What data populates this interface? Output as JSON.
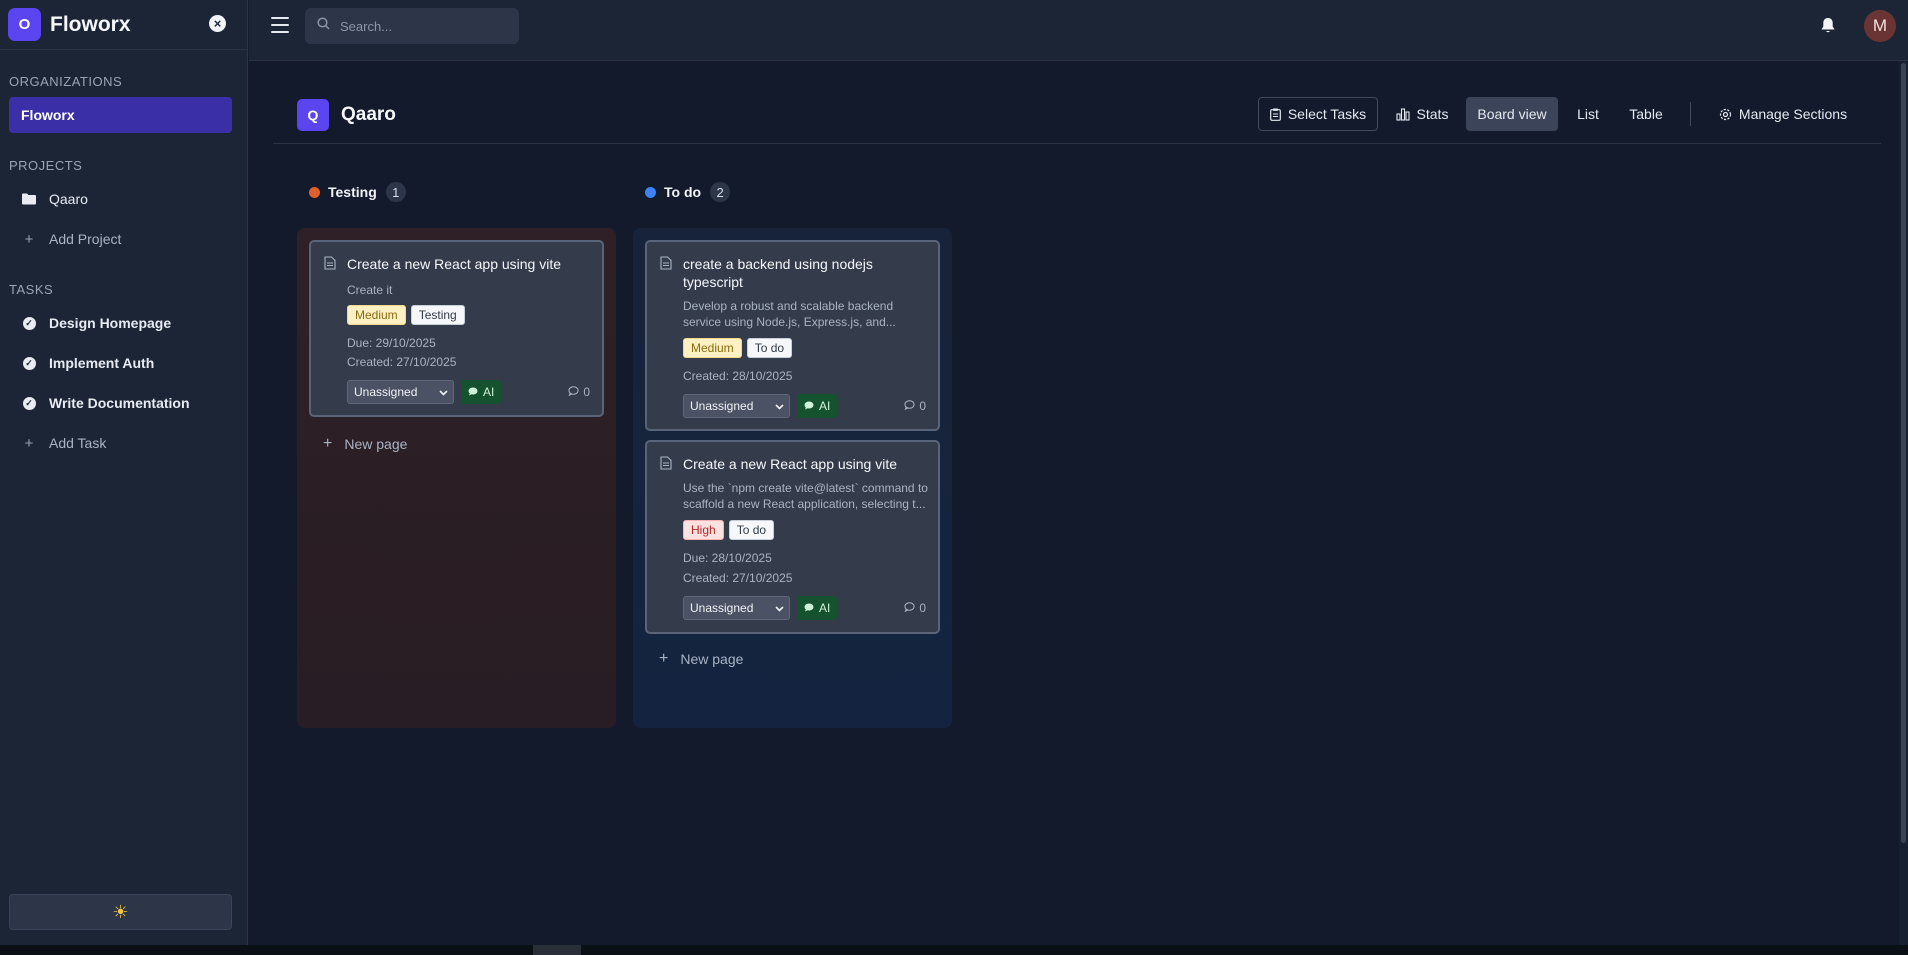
{
  "brand": {
    "logo_letter": "O",
    "name": "Floworx"
  },
  "sidebar": {
    "organizations_heading": "ORGANIZATIONS",
    "organizations": [
      {
        "label": "Floworx"
      }
    ],
    "projects_heading": "PROJECTS",
    "projects": [
      {
        "label": "Qaaro"
      }
    ],
    "add_project_label": "Add Project",
    "tasks_heading": "TASKS",
    "tasks": [
      {
        "label": "Design Homepage"
      },
      {
        "label": "Implement Auth"
      },
      {
        "label": "Write Documentation"
      }
    ],
    "add_task_label": "Add Task"
  },
  "search": {
    "placeholder": "Search..."
  },
  "user": {
    "avatar_letter": "M"
  },
  "project": {
    "icon_letter": "Q",
    "title": "Qaaro"
  },
  "toolbar": {
    "select_tasks": "Select Tasks",
    "stats": "Stats",
    "board_view": "Board view",
    "list": "List",
    "table": "Table",
    "manage_sections": "Manage Sections",
    "active_view": "Board view"
  },
  "columns": [
    {
      "name": "Testing",
      "count": "1",
      "color": "#e0602c",
      "new_page_label": "New page",
      "cards": [
        {
          "title": "Create a new React app using vite",
          "description": "Create it",
          "priority": "Medium",
          "status": "Testing",
          "due": "Due: 29/10/2025",
          "created": "Created: 27/10/2025",
          "assignee": "Unassigned",
          "ai_label": "AI",
          "comments": "0"
        }
      ]
    },
    {
      "name": "To do",
      "count": "2",
      "color": "#3b82f6",
      "new_page_label": "New page",
      "cards": [
        {
          "title": "create a backend using nodejs typescript",
          "description": "Develop a robust and scalable backend service using Node.js, Express.js, and...",
          "priority": "Medium",
          "status": "To do",
          "created": "Created: 28/10/2025",
          "assignee": "Unassigned",
          "ai_label": "AI",
          "comments": "0"
        },
        {
          "title": "Create a new React app using vite",
          "description": "Use the `npm create vite@latest` command to scaffold a new React application, selecting t...",
          "priority": "High",
          "status": "To do",
          "due": "Due: 28/10/2025",
          "created": "Created: 27/10/2025",
          "assignee": "Unassigned",
          "ai_label": "AI",
          "comments": "0"
        }
      ]
    }
  ],
  "theme": {
    "toggle_icon": "sun-icon",
    "accent": "#5b45f0"
  }
}
